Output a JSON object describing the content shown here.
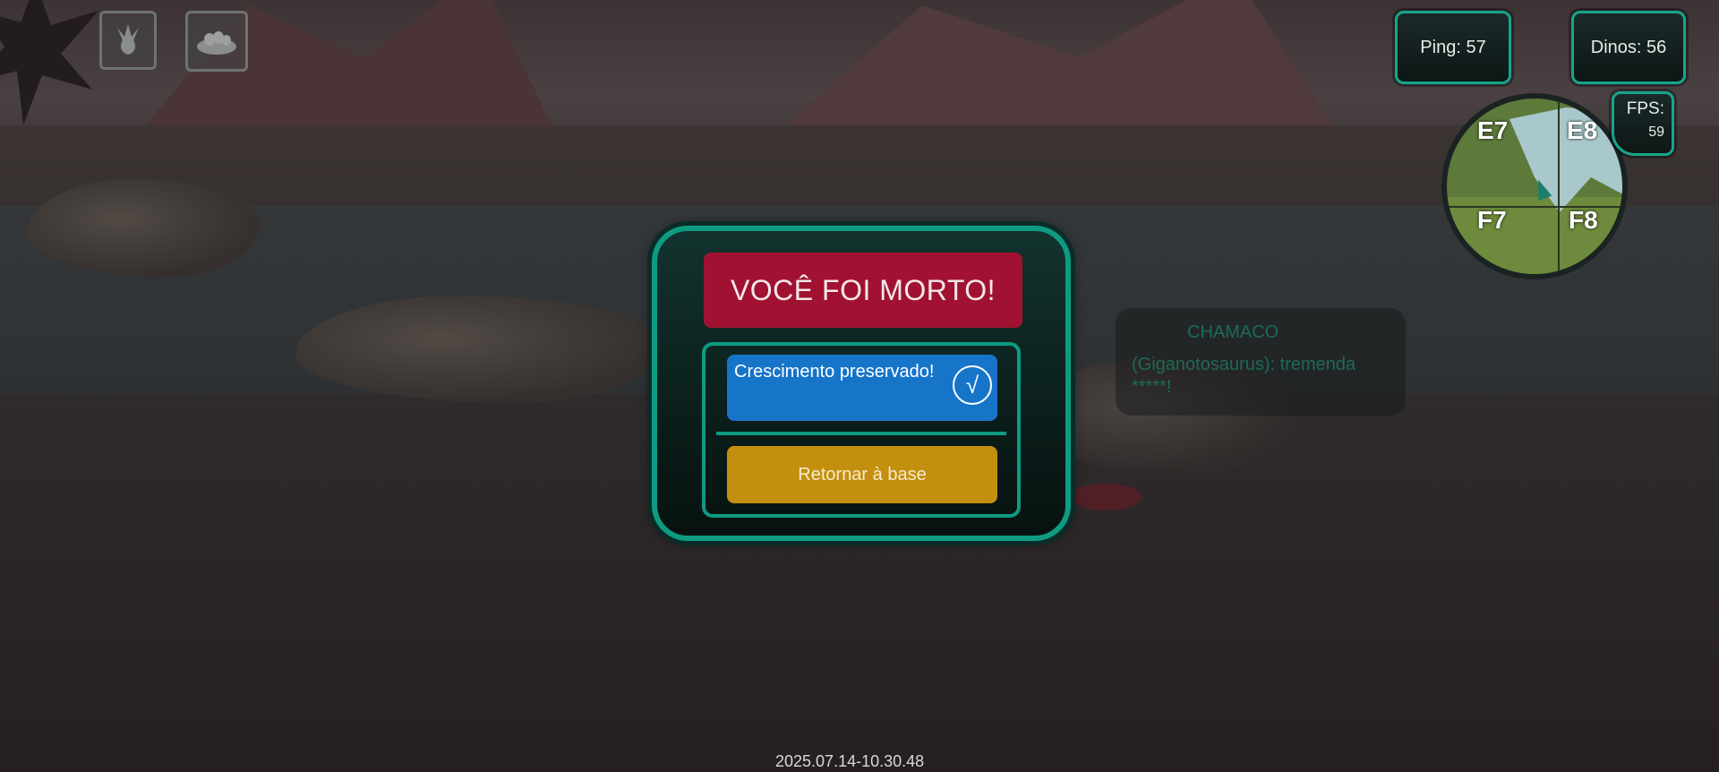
{
  "hud": {
    "ping_label": "Ping: 57",
    "dinos_label": "Dinos: 56",
    "fps_label": "FPS:",
    "fps_value": "59"
  },
  "toolbar": {
    "tracks_icon": "dino-footprint-icon",
    "nest_icon": "nest-icon"
  },
  "minimap": {
    "cells": [
      "E7",
      "E8",
      "F7",
      "F8"
    ]
  },
  "chat": {
    "sender": "CHAMACO",
    "message": "(Giganotosaurus): tremenda *****!"
  },
  "death_dialog": {
    "title": "VOCÊ FOI MORTO!",
    "growth_label": "Crescimento preservado!",
    "growth_icon": "checkmark-icon",
    "growth_check": "√",
    "return_label": "Retornar à base",
    "colors": {
      "title_bg": "#a11232",
      "growth_bg": "#1674c9",
      "return_bg": "#c2900e",
      "border": "#0e9b82"
    }
  },
  "footer": {
    "timestamp": "2025.07.14-10.30.48"
  }
}
